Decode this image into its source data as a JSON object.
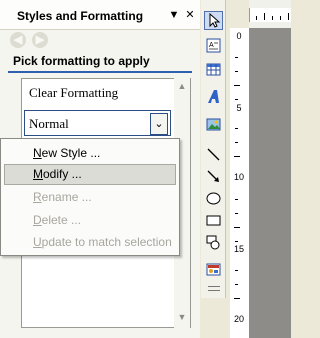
{
  "pane": {
    "title": "Styles and Formatting",
    "menu_arrow": "▼",
    "close": "✕",
    "back_icon": "◀",
    "forward_icon": "▶",
    "heading": "Pick formatting to apply",
    "list_items": [
      "Clear Formatting"
    ],
    "current_style": "Normal",
    "dropdown_arrow": "⌄"
  },
  "context_menu": {
    "items": [
      {
        "pre": "",
        "key": "N",
        "post": "ew Style ...",
        "enabled": true
      },
      {
        "pre": "",
        "key": "M",
        "post": "odify ...",
        "enabled": true,
        "highlighted": true
      },
      {
        "pre": "",
        "key": "R",
        "post": "ename ...",
        "enabled": false
      },
      {
        "pre": "",
        "key": "D",
        "post": "elete ...",
        "enabled": false
      },
      {
        "pre": "",
        "key": "U",
        "post": "pdate to match selection",
        "enabled": false
      }
    ]
  },
  "toolbar": {
    "tools": [
      "pointer-icon",
      "text-box-icon",
      "table-icon",
      "wordart-icon",
      "picture-icon",
      "line-icon",
      "arrow-icon",
      "ellipse-icon",
      "rectangle-icon",
      "autoshape-icon",
      "clip-art-icon"
    ]
  },
  "ruler": {
    "labels": [
      "0",
      "5",
      "10",
      "15",
      "20"
    ]
  }
}
